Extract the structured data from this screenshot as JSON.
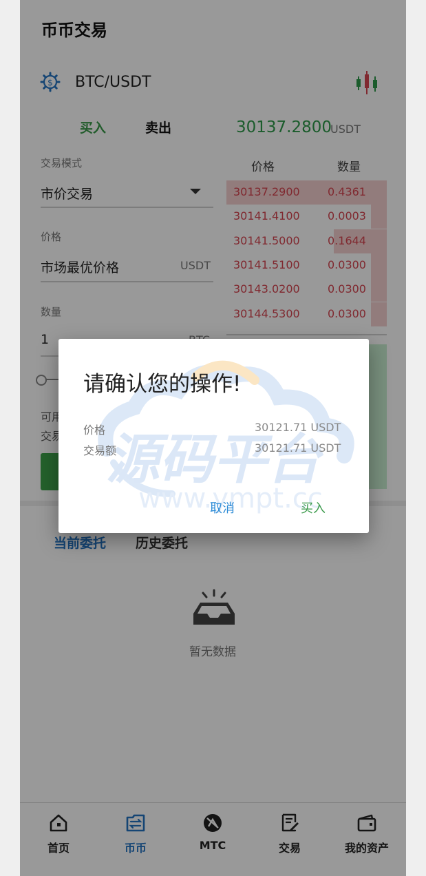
{
  "header": {
    "title": "币币交易"
  },
  "pair": {
    "symbol": "BTC/USDT",
    "settings_icon": "gear-dollar-icon",
    "chart_icon": "candlestick-icon"
  },
  "trade_tabs": {
    "buy": "买入",
    "sell": "卖出"
  },
  "last_price": {
    "value": "30137.2800",
    "unit": "USDT",
    "color": "#2e9a4a"
  },
  "form": {
    "mode_label": "交易模式",
    "mode_value": "市价交易",
    "price_label": "价格",
    "price_value": "市场最优价格",
    "price_unit": "USDT",
    "qty_label": "数量",
    "qty_value": "1",
    "qty_unit": "BTC",
    "available_label": "可用",
    "volume_label": "交易额"
  },
  "orderbook": {
    "price_header": "价格",
    "qty_header": "数量",
    "asks": [
      {
        "price": "30137.2900",
        "qty": "0.4361",
        "depth": 1.0
      },
      {
        "price": "30141.4100",
        "qty": "0.0003",
        "depth": 0.1
      },
      {
        "price": "30141.5000",
        "qty": "0.1644",
        "depth": 0.33
      },
      {
        "price": "30141.5100",
        "qty": "0.0300",
        "depth": 0.1
      },
      {
        "price": "30143.0200",
        "qty": "0.0300",
        "depth": 0.1
      },
      {
        "price": "30144.5300",
        "qty": "0.0300",
        "depth": 0.1
      }
    ],
    "ask_color": "#d64550"
  },
  "orders": {
    "tab_current": "当前委托",
    "tab_history": "历史委托",
    "empty_text": "暂无数据",
    "empty_icon": "inbox-icon"
  },
  "bottom_nav": [
    {
      "label": "首页",
      "icon": "home-icon"
    },
    {
      "label": "币币",
      "icon": "exchange-icon",
      "active": true
    },
    {
      "label": "MTC",
      "icon": "mtc-coin-icon"
    },
    {
      "label": "交易",
      "icon": "document-edit-icon"
    },
    {
      "label": "我的资产",
      "icon": "wallet-icon"
    }
  ],
  "dialog": {
    "title": "请确认您的操作!",
    "price_label": "价格",
    "price_value": "30121.71 USDT",
    "amount_label": "交易额",
    "amount_value": "30121.71 USDT",
    "cancel": "取消",
    "confirm": "买入"
  },
  "watermark": {
    "main": "源码平台",
    "url": "www.ympt.cc"
  }
}
